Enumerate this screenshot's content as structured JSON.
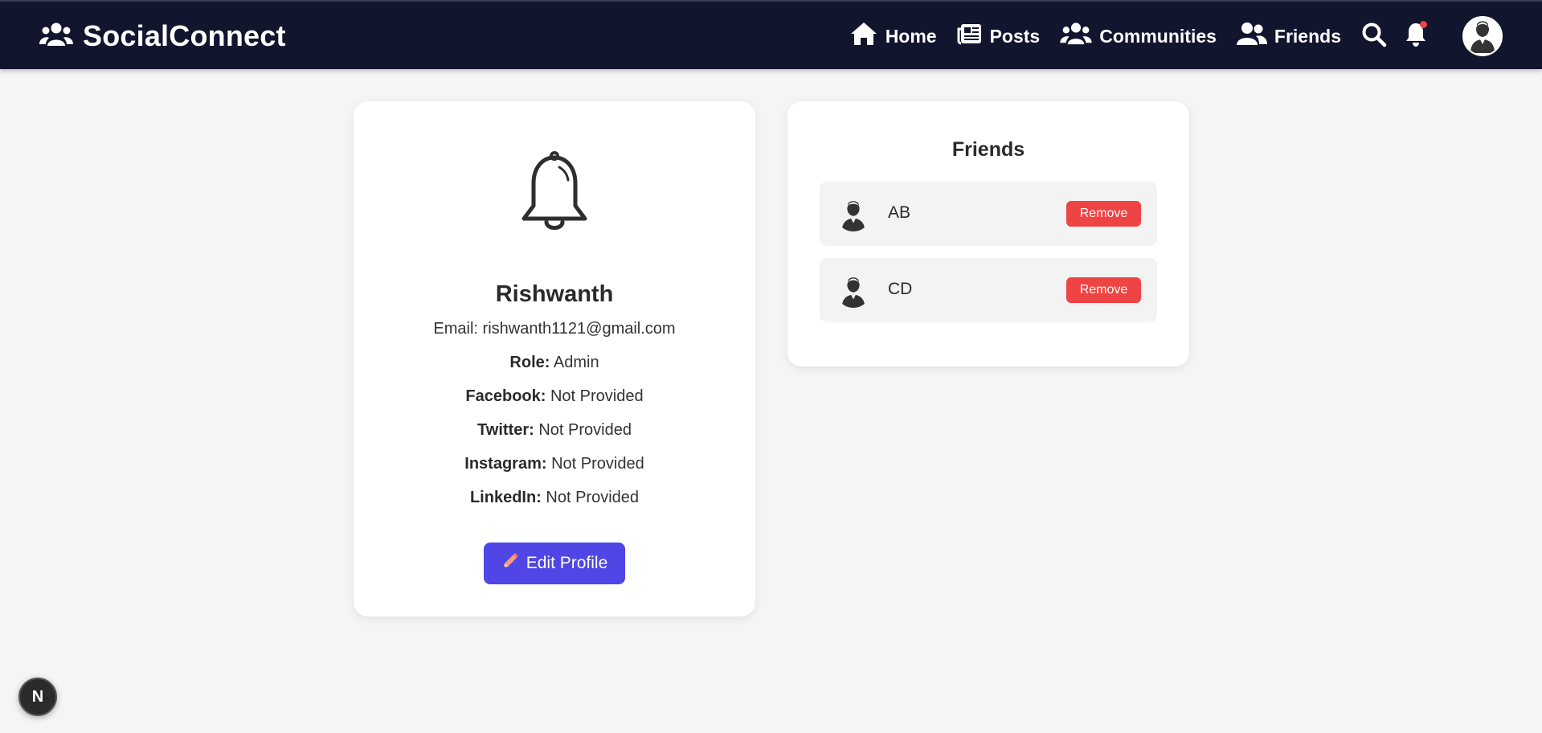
{
  "app": {
    "brand": "SocialConnect"
  },
  "nav": {
    "home": "Home",
    "posts": "Posts",
    "communities": "Communities",
    "friends": "Friends"
  },
  "profile": {
    "name": "Rishwanth",
    "email_label": "Email:",
    "email": "rishwanth1121@gmail.com",
    "fields": [
      {
        "label": "Role:",
        "value": "Admin"
      },
      {
        "label": "Facebook:",
        "value": "Not Provided"
      },
      {
        "label": "Twitter:",
        "value": "Not Provided"
      },
      {
        "label": "Instagram:",
        "value": "Not Provided"
      },
      {
        "label": "LinkedIn:",
        "value": "Not Provided"
      }
    ],
    "edit_label": "Edit Profile"
  },
  "friends": {
    "title": "Friends",
    "items": [
      {
        "name": "AB",
        "action": "Remove"
      },
      {
        "name": "CD",
        "action": "Remove"
      }
    ]
  },
  "dev_badge": {
    "label": "N"
  },
  "colors": {
    "navbar": "#12152e",
    "primary": "#4f46e5",
    "danger": "#ef4444",
    "background": "#f5f5f5"
  },
  "icons": {
    "brand": "users-icon",
    "home": "home-icon",
    "posts": "newspaper-icon",
    "communities": "users-icon",
    "friends": "user-friends-icon",
    "search": "search-icon",
    "notifications": "bell-icon",
    "profile_avatar": "avatar-icon",
    "edit": "pencil-icon"
  }
}
